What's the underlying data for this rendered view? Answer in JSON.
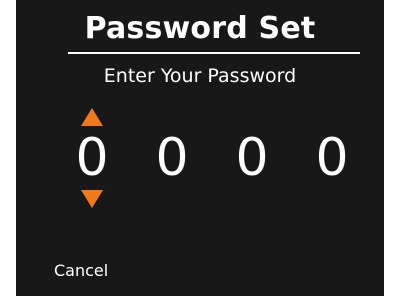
{
  "header": {
    "title": "Password Set",
    "subtitle": "Enter Your Password"
  },
  "password": {
    "digits": [
      "0",
      "0",
      "0",
      "0"
    ],
    "selected_index": 0,
    "increment_icon": "triangle-up",
    "decrement_icon": "triangle-down",
    "accent_color": "#f07a1a"
  },
  "footer": {
    "cancel_label": "Cancel"
  },
  "colors": {
    "background": "#181818",
    "text": "#ffffff"
  }
}
